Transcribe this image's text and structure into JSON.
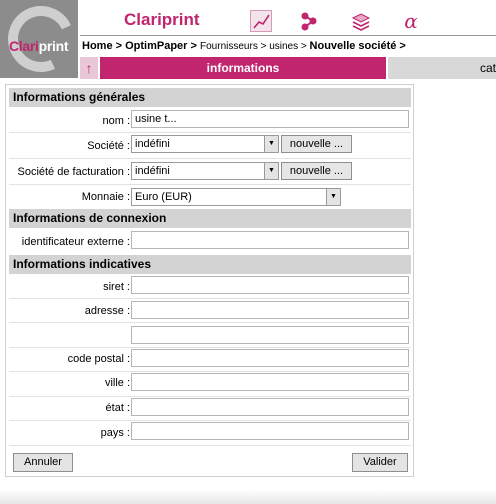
{
  "header": {
    "logo_text_a": "Clari",
    "logo_text_b": "print",
    "brand": "Clariprint",
    "icons": [
      "graph-icon",
      "share-icon",
      "layers-icon",
      "alpha-icon"
    ],
    "alpha_glyph": "α"
  },
  "breadcrumb": {
    "home": "Home",
    "sep1": " > ",
    "optim": "OptimPaper",
    "sep2": " > ",
    "fournisseurs": "Fournisseurs > usines",
    "sep3": " > ",
    "current": "Nouvelle société >"
  },
  "nav": {
    "up_glyph": "↑",
    "active_tab": "informations",
    "other_tab": "cat"
  },
  "sections": {
    "general": "Informations générales",
    "connexion": "Informations de connexion",
    "indicatives": "Informations indicatives"
  },
  "form": {
    "nom_label": "nom :",
    "nom_value": "usine t...",
    "societe_label": "Société :",
    "societe_value": "indéfini",
    "societe_btn": "nouvelle ...",
    "facturation_label": "Société de facturation :",
    "facturation_value": "indéfini",
    "facturation_btn": "nouvelle ...",
    "monnaie_label": "Monnaie :",
    "monnaie_value": "Euro (EUR)",
    "identificateur_label": "identificateur externe :",
    "siret_label": "siret :",
    "adresse_label": "adresse :",
    "code_postal_label": "code postal :",
    "ville_label": "ville :",
    "etat_label": "état :",
    "pays_label": "pays :"
  },
  "footer": {
    "annuler": "Annuler",
    "valider": "Valider"
  },
  "colors": {
    "brand": "#c0256e",
    "section_bg": "#d3d3d3"
  }
}
